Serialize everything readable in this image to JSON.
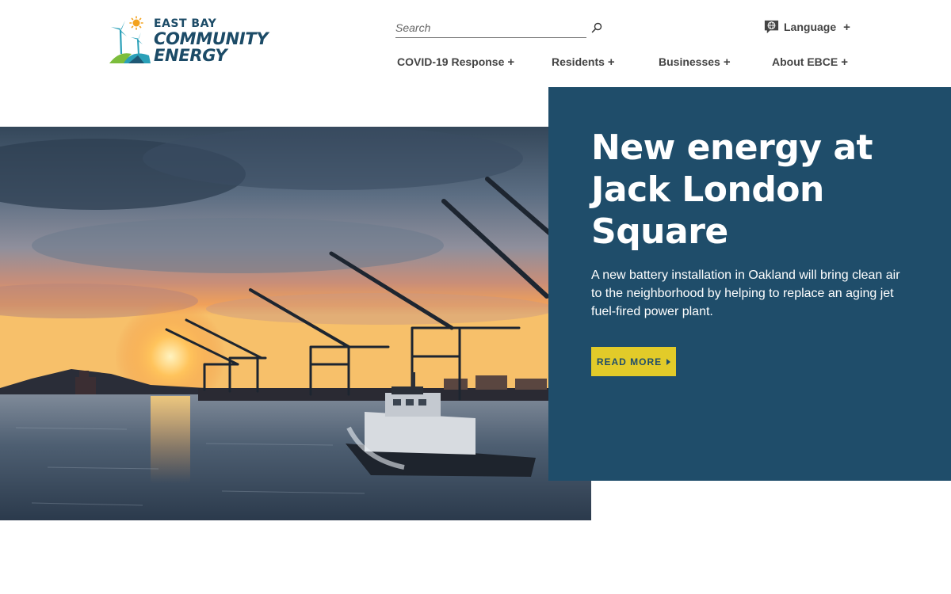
{
  "header": {
    "logo": {
      "line1": "EAST BAY",
      "line2": "COMMUNITY",
      "line3": "ENERGY"
    },
    "search": {
      "placeholder": "Search",
      "icon": "search-icon"
    },
    "language": {
      "label": "Language",
      "icon": "globe-speech-icon",
      "expand": "+"
    },
    "nav": [
      {
        "label": "COVID-19 Response",
        "expand": "+"
      },
      {
        "label": "Residents",
        "expand": "+"
      },
      {
        "label": "Businesses",
        "expand": "+"
      },
      {
        "label": "About EBCE",
        "expand": "+"
      }
    ]
  },
  "hero": {
    "title": "New energy at Jack London Square",
    "text": "A new battery installation in Oakland will bring clean air to the neighborhood by helping to replace an aging jet fuel-fired power plant.",
    "button_label": "READ MORE"
  },
  "colors": {
    "panel": "#1f4d6a",
    "button": "#e2cb29",
    "brand_navy": "#1c4b67",
    "brand_teal": "#2aa0b8",
    "brand_green": "#7cbd3c",
    "sun": "#f3a21d"
  }
}
